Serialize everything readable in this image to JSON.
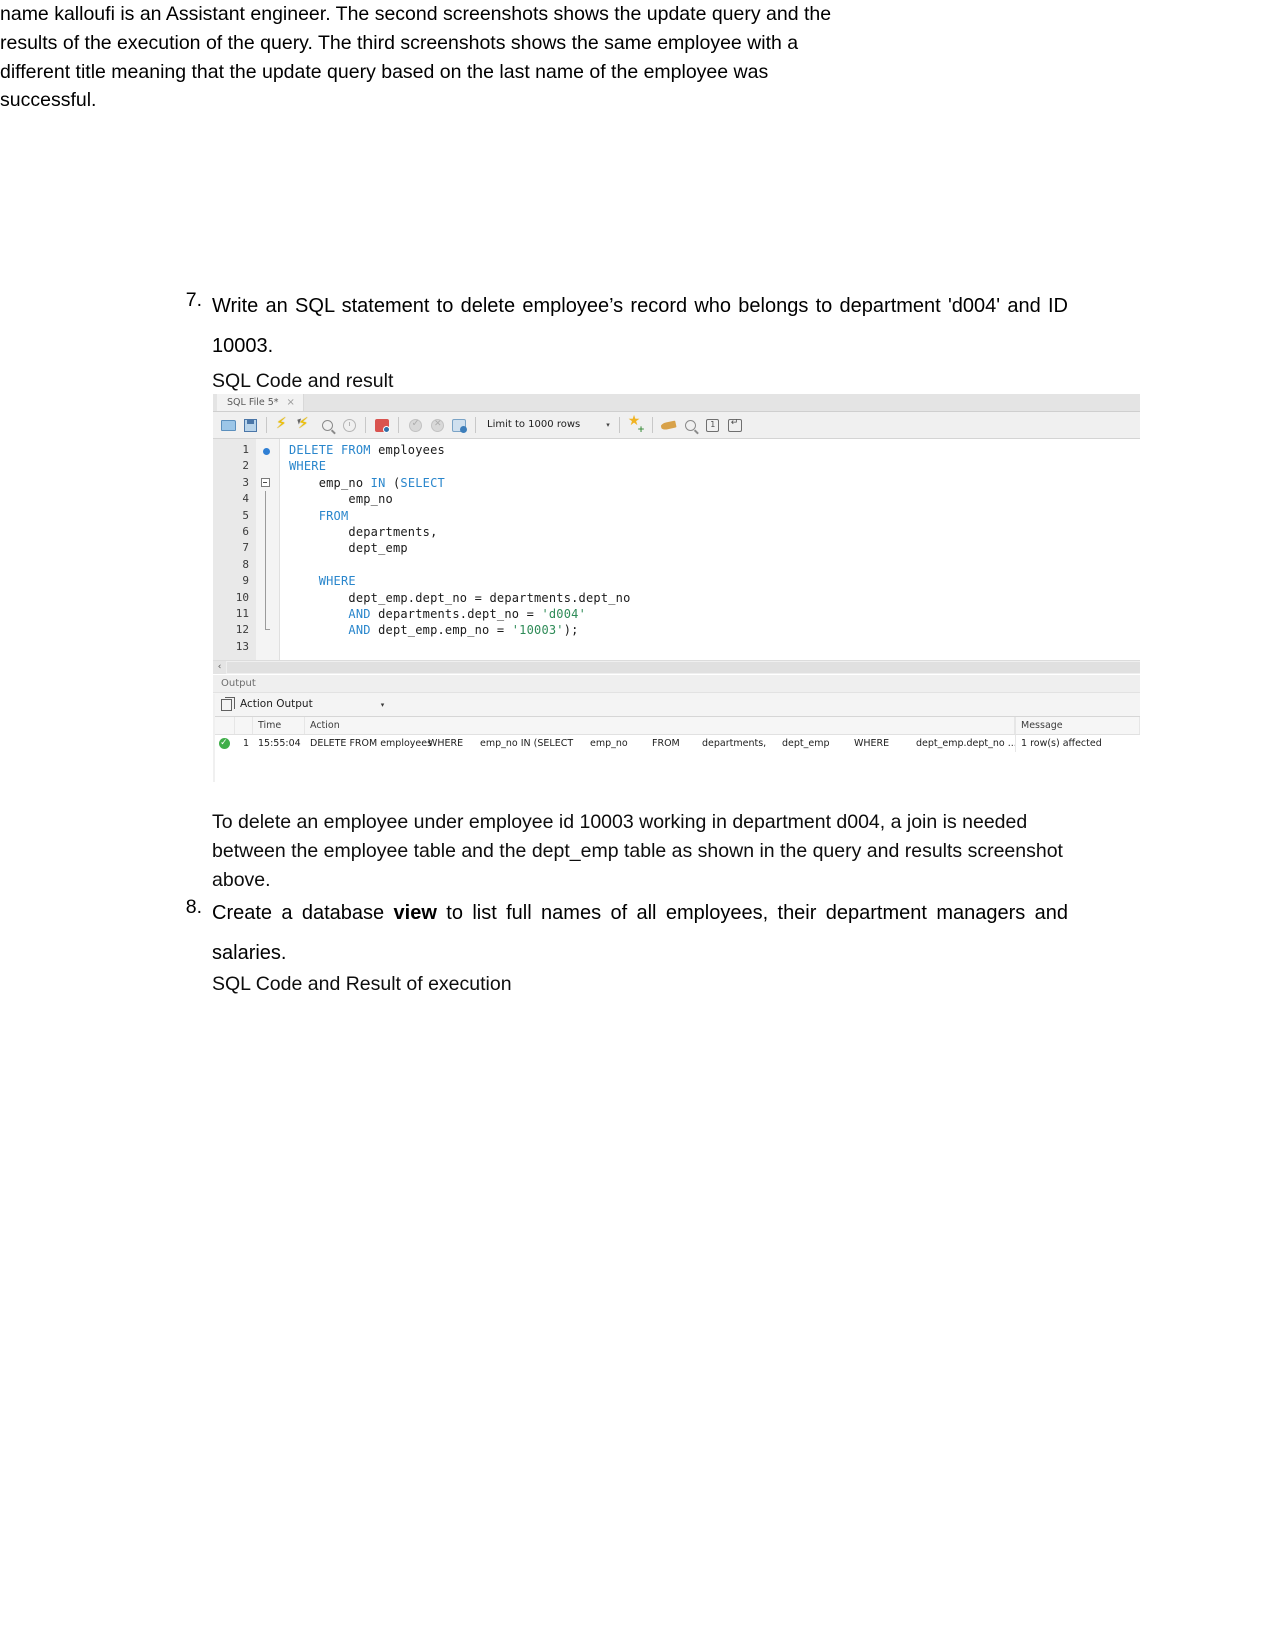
{
  "document": {
    "intro_paragraph": "name kalloufi is an Assistant engineer. The second screenshots shows the update query and the results of the execution of the query. The third screenshots shows the same employee with a different title meaning that the update query based on the last name of the employee was successful.",
    "question7": {
      "number": "7.",
      "text": "Write an SQL statement to delete employee’s record who belongs to department 'd004' and ID 10003."
    },
    "caption_sql_code_result": "SQL Code and result",
    "explanation": "To delete an employee under employee id 10003 working in department d004, a join is needed between the employee table and the dept_emp table as shown in the query and results screenshot above.",
    "question8": {
      "number": "8.",
      "text_before_bold": "Create a database ",
      "bold_word": "view",
      "text_after_bold": " to list full names of all employees, their department managers and salaries."
    },
    "caption_sql_code_execution": "SQL Code and Result of execution"
  },
  "workbench": {
    "tab": {
      "label": "SQL File 5*",
      "close_glyph": "×"
    },
    "toolbar": {
      "icons": [
        "open-folder-icon",
        "save-icon",
        "execute-icon",
        "execute-current-statement-icon",
        "explain-icon",
        "stop-icon",
        "toggle-explain-icon",
        "commit-icon",
        "rollback-icon",
        "autocommit-icon",
        "star-icon",
        "beautify-icon",
        "find-icon",
        "invisible-chars-icon",
        "wrap-lines-icon"
      ],
      "limit_label": "Limit to 1000 rows",
      "limit_caret": "▾",
      "box_num_label": "1"
    },
    "editor": {
      "lines": [
        {
          "num": "1",
          "marker": "breakpoint",
          "tokens": [
            {
              "t": "DELETE FROM ",
              "c": "kw"
            },
            {
              "t": "employees",
              "c": "plain"
            }
          ]
        },
        {
          "num": "2",
          "marker": "none",
          "tokens": [
            {
              "t": "WHERE",
              "c": "kw"
            }
          ]
        },
        {
          "num": "3",
          "marker": "fold-open",
          "tokens": [
            {
              "t": "    emp_no ",
              "c": "plain"
            },
            {
              "t": "IN",
              "c": "kw"
            },
            {
              "t": " (",
              "c": "plain"
            },
            {
              "t": "SELECT",
              "c": "kw"
            }
          ]
        },
        {
          "num": "4",
          "marker": "fold-line",
          "tokens": [
            {
              "t": "        emp_no",
              "c": "plain"
            }
          ]
        },
        {
          "num": "5",
          "marker": "fold-line",
          "tokens": [
            {
              "t": "    FROM",
              "c": "kw"
            }
          ]
        },
        {
          "num": "6",
          "marker": "fold-line",
          "tokens": [
            {
              "t": "        departments,",
              "c": "plain"
            }
          ]
        },
        {
          "num": "7",
          "marker": "fold-line",
          "tokens": [
            {
              "t": "        dept_emp",
              "c": "plain"
            }
          ]
        },
        {
          "num": "8",
          "marker": "fold-line",
          "tokens": [
            {
              "t": "",
              "c": "plain"
            }
          ]
        },
        {
          "num": "9",
          "marker": "fold-line",
          "tokens": [
            {
              "t": "    WHERE",
              "c": "kw"
            }
          ]
        },
        {
          "num": "10",
          "marker": "fold-line",
          "tokens": [
            {
              "t": "        dept_emp.dept_no = departments.dept_no",
              "c": "plain"
            }
          ]
        },
        {
          "num": "11",
          "marker": "fold-line",
          "tokens": [
            {
              "t": "        AND",
              "c": "kw"
            },
            {
              "t": " departments.dept_no = ",
              "c": "plain"
            },
            {
              "t": "'d004'",
              "c": "str"
            }
          ]
        },
        {
          "num": "12",
          "marker": "fold-end",
          "tokens": [
            {
              "t": "        AND",
              "c": "kw"
            },
            {
              "t": " dept_emp.emp_no = ",
              "c": "plain"
            },
            {
              "t": "'10003'",
              "c": "str"
            },
            {
              "t": ");",
              "c": "plain"
            }
          ]
        },
        {
          "num": "13",
          "marker": "none",
          "tokens": [
            {
              "t": "",
              "c": "plain"
            }
          ]
        }
      ]
    },
    "scrollbar": {
      "left_arrow": "‹"
    },
    "output": {
      "panel_title": "Output",
      "selector_label": "Action Output",
      "selector_caret": "▾",
      "columns": [
        "",
        "",
        "Time",
        "Action",
        "Message"
      ],
      "rows": [
        {
          "status": "success",
          "index": "1",
          "time": "15:55:04",
          "action_fragments": [
            "DELETE FROM employees",
            "WHERE",
            "emp_no IN (SELECT",
            "emp_no",
            "FROM",
            "departments,",
            "dept_emp",
            "WHERE",
            "dept_emp.dept_no ..."
          ],
          "message": "1 row(s) affected"
        }
      ]
    }
  },
  "colors": {
    "keyword_blue": "#2986cc",
    "string_green": "#2e8b57",
    "success_green": "#3fae49",
    "toolbar_bg": "#f0f0f0",
    "gutter_bg": "#e9e9e9"
  }
}
